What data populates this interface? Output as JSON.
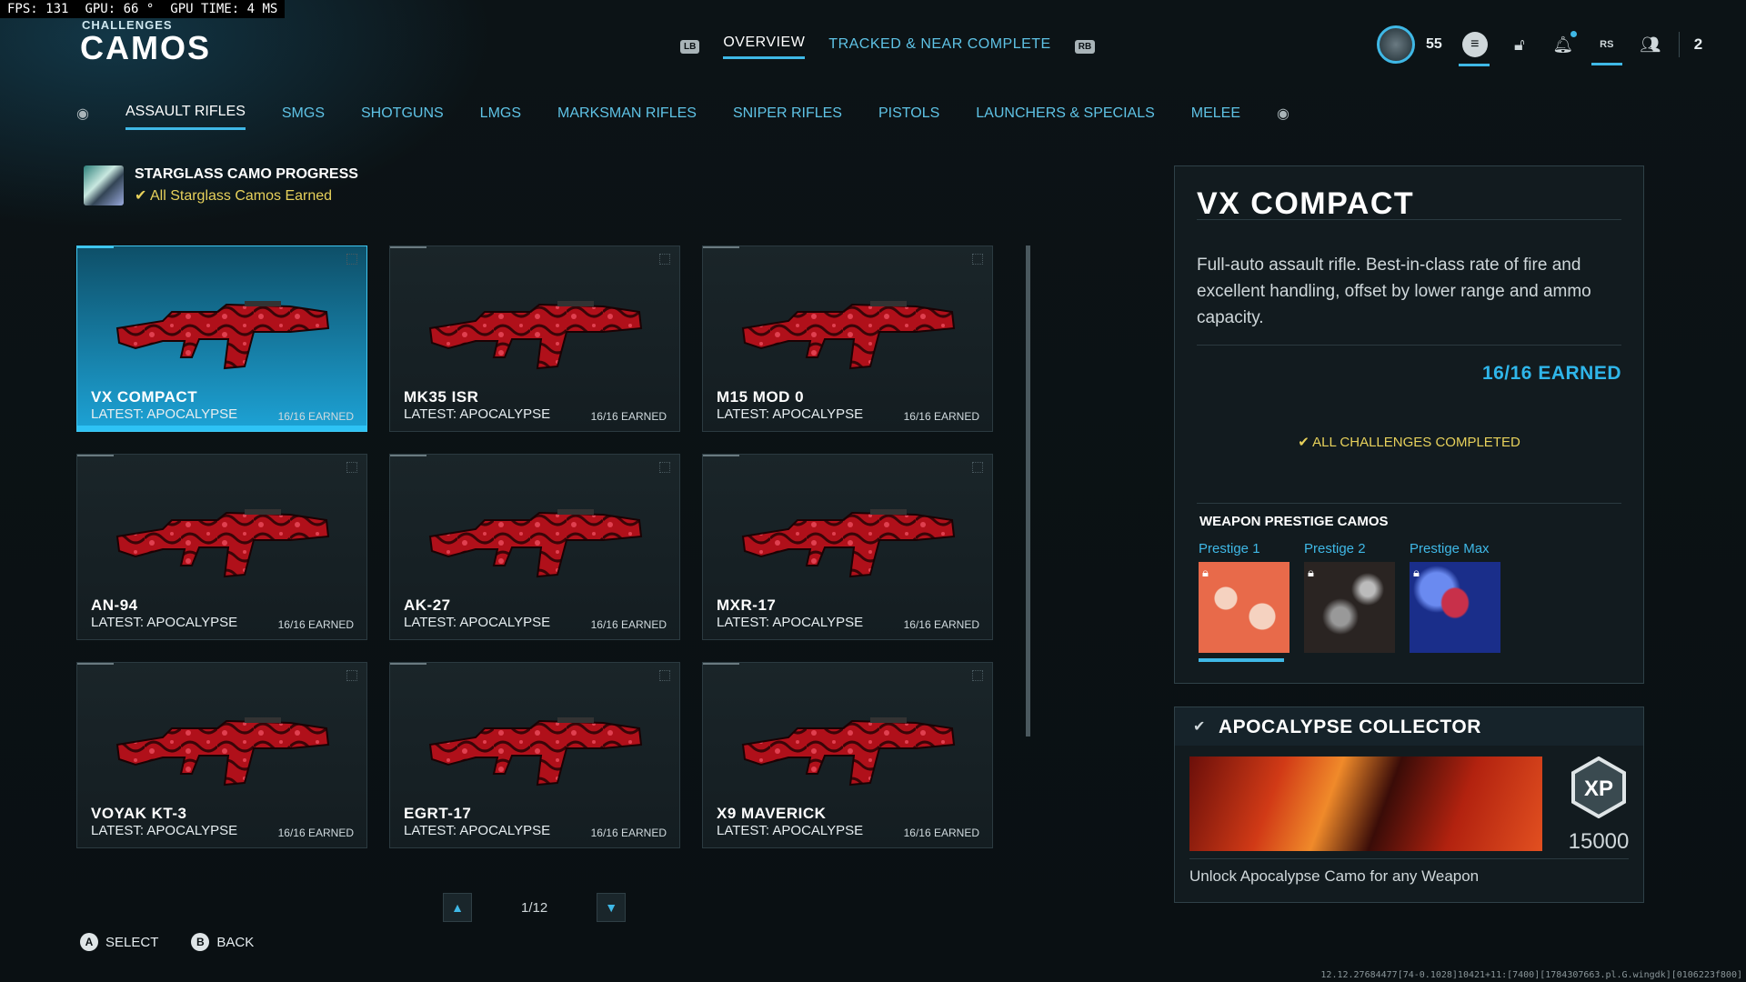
{
  "perf": {
    "fps": "FPS: 131",
    "gpu": "GPU: 66 °",
    "gpu_time": "GPU TIME:  4 MS"
  },
  "header": {
    "section": "CHALLENGES",
    "title": "CAMOS"
  },
  "top_tabs": {
    "lb": "LB",
    "rb": "RB",
    "overview": "OVERVIEW",
    "tracked": "TRACKED & NEAR COMPLETE"
  },
  "player": {
    "level": "55",
    "party_count": "2",
    "rs": "RS"
  },
  "categories": [
    "ASSAULT RIFLES",
    "SMGS",
    "SHOTGUNS",
    "LMGS",
    "MARKSMAN RIFLES",
    "SNIPER RIFLES",
    "PISTOLS",
    "LAUNCHERS & SPECIALS",
    "MELEE"
  ],
  "starglass": {
    "title": "STARGLASS CAMO PROGRESS",
    "status": "All Starglass Camos Earned"
  },
  "weapons": [
    {
      "name": "VX COMPACT",
      "latest": "LATEST: APOCALYPSE",
      "earned": "16/16 EARNED"
    },
    {
      "name": "MK35 ISR",
      "latest": "LATEST: APOCALYPSE",
      "earned": "16/16 EARNED"
    },
    {
      "name": "M15 MOD 0",
      "latest": "LATEST: APOCALYPSE",
      "earned": "16/16 EARNED"
    },
    {
      "name": "AN-94",
      "latest": "LATEST: APOCALYPSE",
      "earned": "16/16 EARNED"
    },
    {
      "name": "AK-27",
      "latest": "LATEST: APOCALYPSE",
      "earned": "16/16 EARNED"
    },
    {
      "name": "MXR-17",
      "latest": "LATEST: APOCALYPSE",
      "earned": "16/16 EARNED"
    },
    {
      "name": "VOYAK KT-3",
      "latest": "LATEST: APOCALYPSE",
      "earned": "16/16 EARNED"
    },
    {
      "name": "EGRT-17",
      "latest": "LATEST: APOCALYPSE",
      "earned": "16/16 EARNED"
    },
    {
      "name": "X9 MAVERICK",
      "latest": "LATEST: APOCALYPSE",
      "earned": "16/16 EARNED"
    }
  ],
  "pager": {
    "page": "1/12"
  },
  "footer": {
    "select_key": "A",
    "select": "SELECT",
    "back_key": "B",
    "back": "BACK"
  },
  "build": "12.12.27684477[74-0.1028]10421+11:[7400][1784307663.pl.G.wingdk][0106223f800]",
  "detail": {
    "title": "VX COMPACT",
    "description": "Full-auto assault rifle. Best-in-class rate of fire and excellent handling, offset by lower range and ammo capacity.",
    "earned": "16/16 EARNED",
    "status": "ALL CHALLENGES COMPLETED",
    "prestige_title": "WEAPON PRESTIGE CAMOS",
    "prestige": [
      {
        "label": "Prestige 1",
        "progress": 1.0
      },
      {
        "label": "Prestige 2",
        "progress": 0
      },
      {
        "label": "Prestige Max",
        "progress": 0
      }
    ]
  },
  "collector": {
    "title": "APOCALYPSE COLLECTOR",
    "xp_label": "XP",
    "xp": "15000",
    "description": "Unlock Apocalypse Camo for any Weapon"
  },
  "colors": {
    "accent": "#3fb8e6",
    "gold": "#e7d15b",
    "camo_red": "#b0101a"
  }
}
